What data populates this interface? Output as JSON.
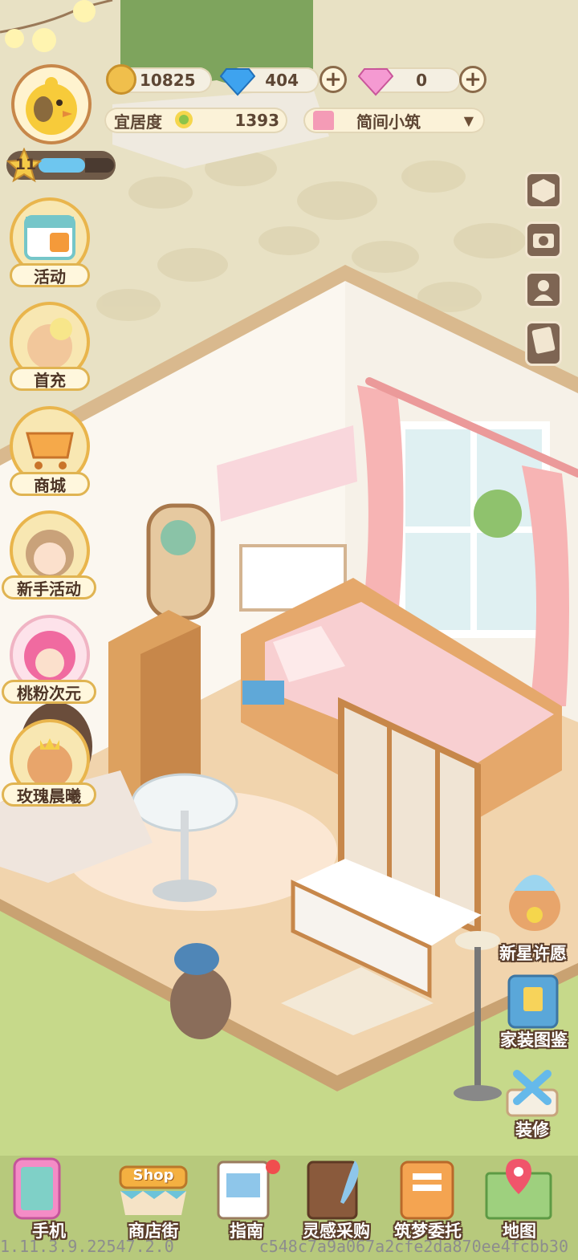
{
  "currency": {
    "coins": "10825",
    "diamonds": "404",
    "gems": "0"
  },
  "comfort": {
    "label": "宜居度",
    "value": "1393"
  },
  "room": {
    "name": "简间小筑"
  },
  "player": {
    "level": "11",
    "exp_fraction": 0.62
  },
  "left_menu": {
    "activity": "活动",
    "first_charge": "首充",
    "shop": "商城",
    "newbie_event": "新手活动",
    "peach_dimension": "桃粉次元",
    "rose_dawn": "玫瑰晨曦"
  },
  "right_menu": {
    "star_wish": "新星许愿",
    "decor_catalog": "家装图鉴",
    "renovate": "装修"
  },
  "bottom_nav": {
    "phone": "手机",
    "shop_street": "商店街",
    "shop_sign": "Shop",
    "guide": "指南",
    "inspiration": "灵感采购",
    "dream_commission": "筑梦委托",
    "map": "地图"
  },
  "footer": {
    "version": "1.11.3.9.22547.2.0",
    "hash": "c548c7a9a067a2cfe2da870ee4fcbb30"
  },
  "colors": {
    "grass": "#c6d98a",
    "floor": "#f1d4ad",
    "wall": "#fbf7f0",
    "accent_gold": "#e9b54c",
    "pink": "#f7b4b4"
  }
}
